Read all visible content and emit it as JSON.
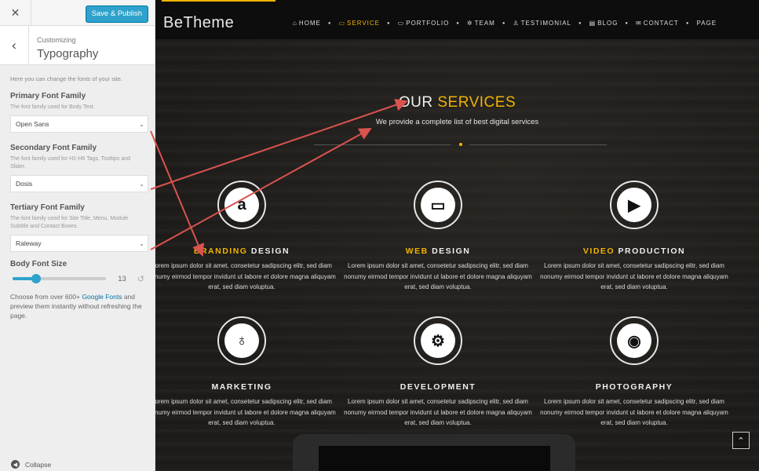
{
  "sidebar": {
    "close_icon": "close-icon",
    "publish_label": "Save & Publish",
    "back_icon": "chevron-left-icon",
    "heading_small": "Customizing",
    "heading_big": "Typography",
    "intro": "Here you can change the fonts of your site.",
    "fields": [
      {
        "label": "Primary Font Family",
        "desc": "The font family used for Body Text.",
        "value": "Open Sans"
      },
      {
        "label": "Secondary Font Family",
        "desc": "The font family used for H1-H6 Tags, Tooltips and Slider.",
        "value": "Dosis"
      },
      {
        "label": "Tertiary Font Family",
        "desc": "The font family used for Site Title, Menu, Module Subtitle and Contact Boxes.",
        "value": "Raleway"
      }
    ],
    "body_size_label": "Body Font Size",
    "body_size_value": "13",
    "body_size_fraction": 0.25,
    "choose_prefix": "Choose from over 600+ ",
    "choose_link": "Google Fonts",
    "choose_suffix": " and preview them instantly without refreshing the page.",
    "collapse_label": "Collapse"
  },
  "preview": {
    "logo": "BeTheme",
    "nav": [
      {
        "label": "HOME",
        "icon": "home-icon",
        "active": false
      },
      {
        "label": "SERVICE",
        "icon": "monitor-icon",
        "active": true
      },
      {
        "label": "PORTFOLIO",
        "icon": "folder-icon",
        "active": false
      },
      {
        "label": "TEAM",
        "icon": "team-icon",
        "active": false
      },
      {
        "label": "TESTIMONIAL",
        "icon": "thumbs-up-icon",
        "active": false
      },
      {
        "label": "BLOG",
        "icon": "blog-icon",
        "active": false
      },
      {
        "label": "CONTACT",
        "icon": "mail-icon",
        "active": false
      },
      {
        "label": "PAGE",
        "icon": "",
        "active": false
      }
    ],
    "title_plain": "OUR",
    "title_highlight": " SERVICES",
    "subtitle": "We provide a complete list of best digital services",
    "services": [
      {
        "hl": "BRANDING",
        "rest": " DESIGN",
        "icon": "amazon-icon",
        "glyph": "a",
        "text": "Lorem ipsum dolor sit amet, consetetur sadipscing elitr, sed diam nonumy eirmod tempor invidunt ut labore et dolore magna aliquyam erat, sed diam voluptua."
      },
      {
        "hl": "WEB",
        "rest": " DESIGN",
        "icon": "laptop-icon",
        "glyph": "▭",
        "text": "Lorem ipsum dolor sit amet, consetetur sadipscing elitr, sed diam nonumy eirmod tempor invidunt ut labore et dolore magna aliquyam erat, sed diam voluptua."
      },
      {
        "hl": "VIDEO",
        "rest": " PRODUCTION",
        "icon": "video-camera-icon",
        "glyph": "▶",
        "text": "Lorem ipsum dolor sit amet, consetetur sadipscing elitr, sed diam nonumy eirmod tempor invidunt ut labore et dolore magna aliquyam erat, sed diam voluptua."
      },
      {
        "hl": "",
        "rest": "MARKETING",
        "icon": "microphone-icon",
        "glyph": "♁",
        "text": "Lorem ipsum dolor sit amet, consetetur sadipscing elitr, sed diam nonumy eirmod tempor invidunt ut labore et dolore magna aliquyam erat, sed diam voluptua."
      },
      {
        "hl": "",
        "rest": "DEVELOPMENT",
        "icon": "gears-icon",
        "glyph": "⚙",
        "text": "Lorem ipsum dolor sit amet, consetetur sadipscing elitr, sed diam nonumy eirmod tempor invidunt ut labore et dolore magna aliquyam erat, sed diam voluptua."
      },
      {
        "hl": "",
        "rest": "PHOTOGRAPHY",
        "icon": "camera-icon",
        "glyph": "◉",
        "text": "Lorem ipsum dolor sit amet, consetetur sadipscing elitr, sed diam nonumy eirmod tempor invidunt ut labore et dolore magna aliquyam erat, sed diam voluptua."
      }
    ],
    "scroll_top_icon": "chevron-up-icon"
  },
  "colors": {
    "accent": "#f0b400",
    "publish": "#2ea2cc",
    "arrow": "#d9534f"
  }
}
